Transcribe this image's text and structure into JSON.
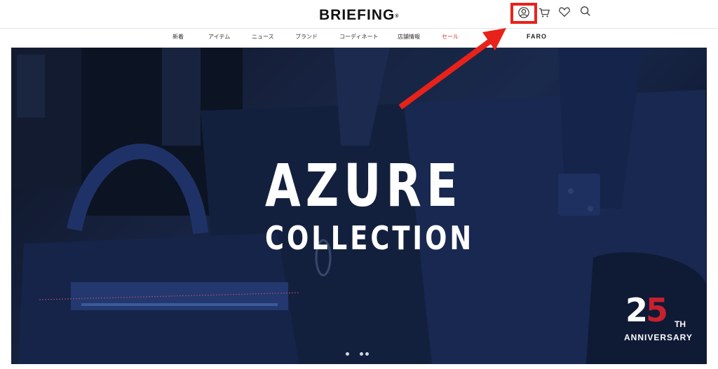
{
  "header": {
    "logo": "BRIEFING",
    "logo_mark": "®",
    "icons": [
      "account-icon",
      "cart-icon",
      "wishlist-heart-icon",
      "search-icon"
    ]
  },
  "nav": {
    "items": [
      {
        "label": "新着"
      },
      {
        "label": "アイテム"
      },
      {
        "label": "ニュース"
      },
      {
        "label": "ブランド"
      },
      {
        "label": "コーディネート"
      },
      {
        "label": "店舗情報"
      },
      {
        "label": "セール"
      },
      {
        "label": "FARO"
      }
    ]
  },
  "hero": {
    "title": "AZURE",
    "subtitle": "COLLECTION",
    "anniversary": {
      "number_a": "2",
      "number_b": "5",
      "suffix": "TH",
      "label": "ANNIVERSARY"
    },
    "carousel_dots": 3,
    "active_dot": 0
  },
  "annotation": {
    "highlight_color": "#e8221a"
  }
}
